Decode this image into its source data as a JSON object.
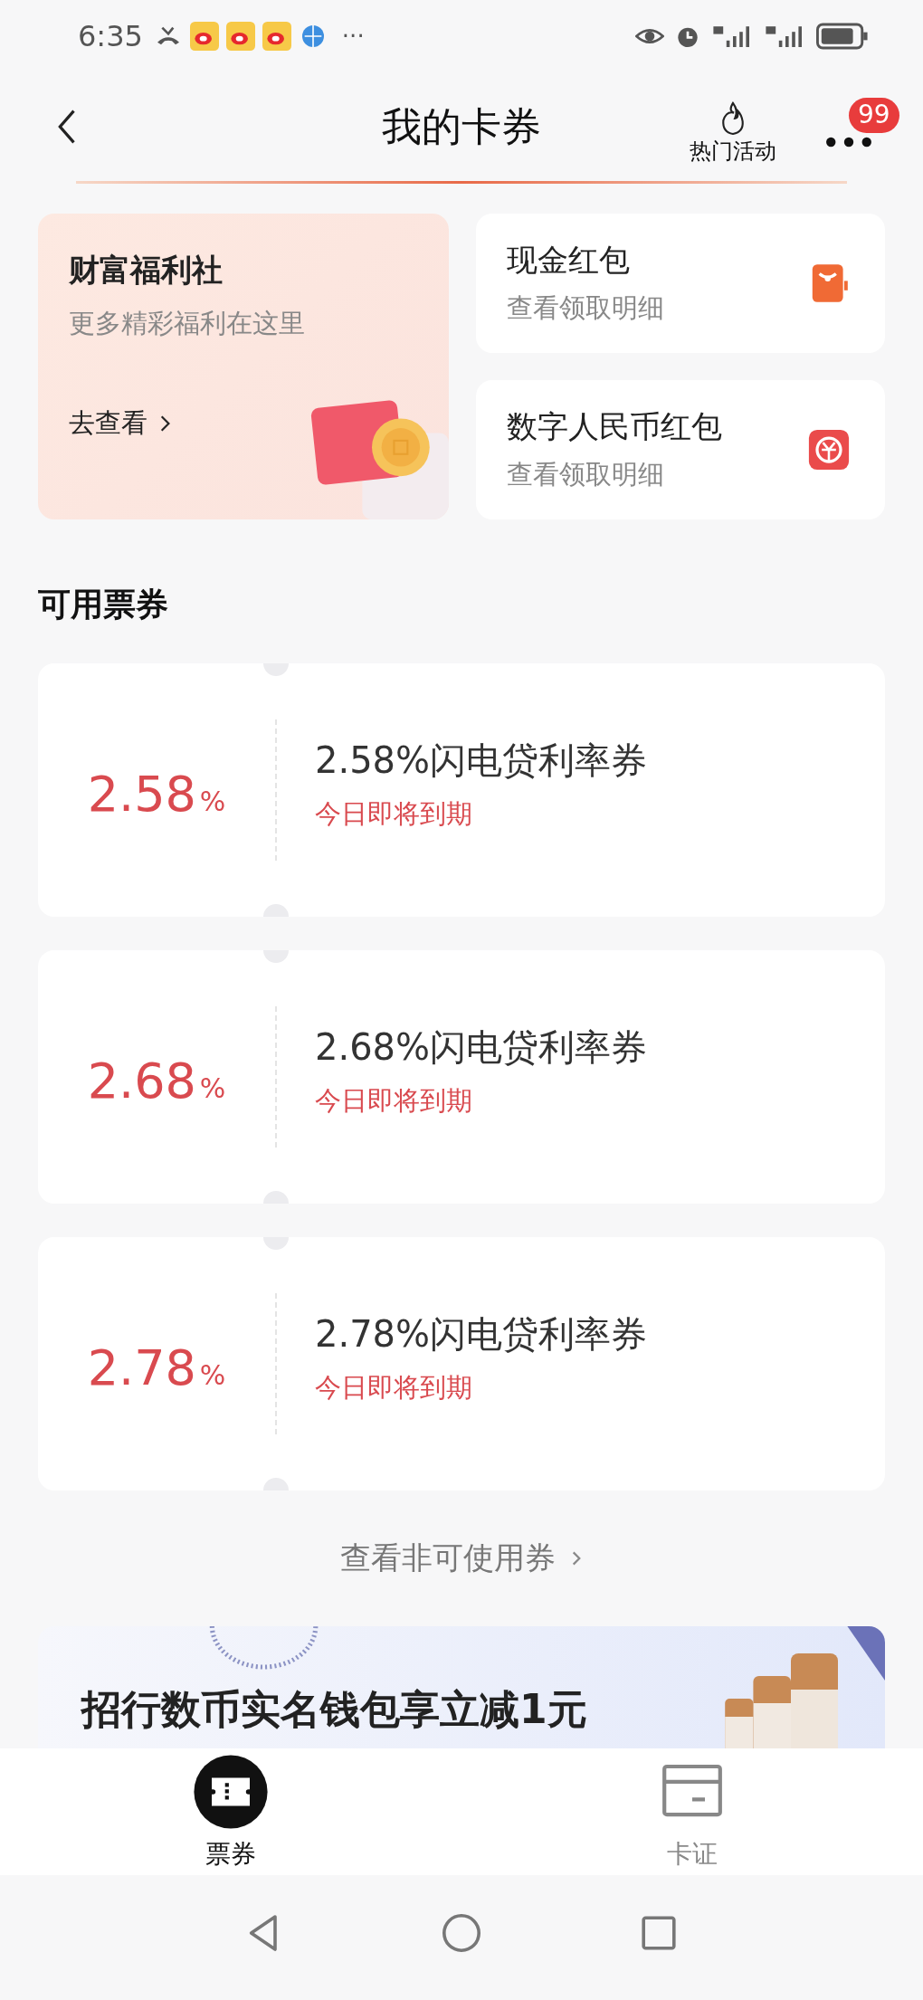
{
  "status_bar": {
    "time": "6:35",
    "more": "···"
  },
  "header": {
    "title": "我的卡券",
    "hot_label": "热门活动",
    "badge": "99"
  },
  "welfare": {
    "title": "财富福利社",
    "subtitle": "更多精彩福利在这里",
    "link": "去查看"
  },
  "quick_links": [
    {
      "kind": "cash",
      "title": "现金红包",
      "subtitle": "查看领取明细"
    },
    {
      "kind": "digital",
      "title": "数字人民币红包",
      "subtitle": "查看领取明细"
    }
  ],
  "section_title": "可用票券",
  "coupons": [
    {
      "value": "2.58",
      "unit": "%",
      "name": "2.58%闪电贷利率券",
      "note": "今日即将到期"
    },
    {
      "value": "2.68",
      "unit": "%",
      "name": "2.68%闪电贷利率券",
      "note": "今日即将到期"
    },
    {
      "value": "2.78",
      "unit": "%",
      "name": "2.78%闪电贷利率券",
      "note": "今日即将到期"
    }
  ],
  "more_link": "查看非可使用券",
  "banner": {
    "text": "招行数币实名钱包享立减1元"
  },
  "tabs": [
    {
      "kind": "ticket",
      "label": "票券",
      "selected": true
    },
    {
      "kind": "card",
      "label": "卡证",
      "selected": false
    }
  ]
}
